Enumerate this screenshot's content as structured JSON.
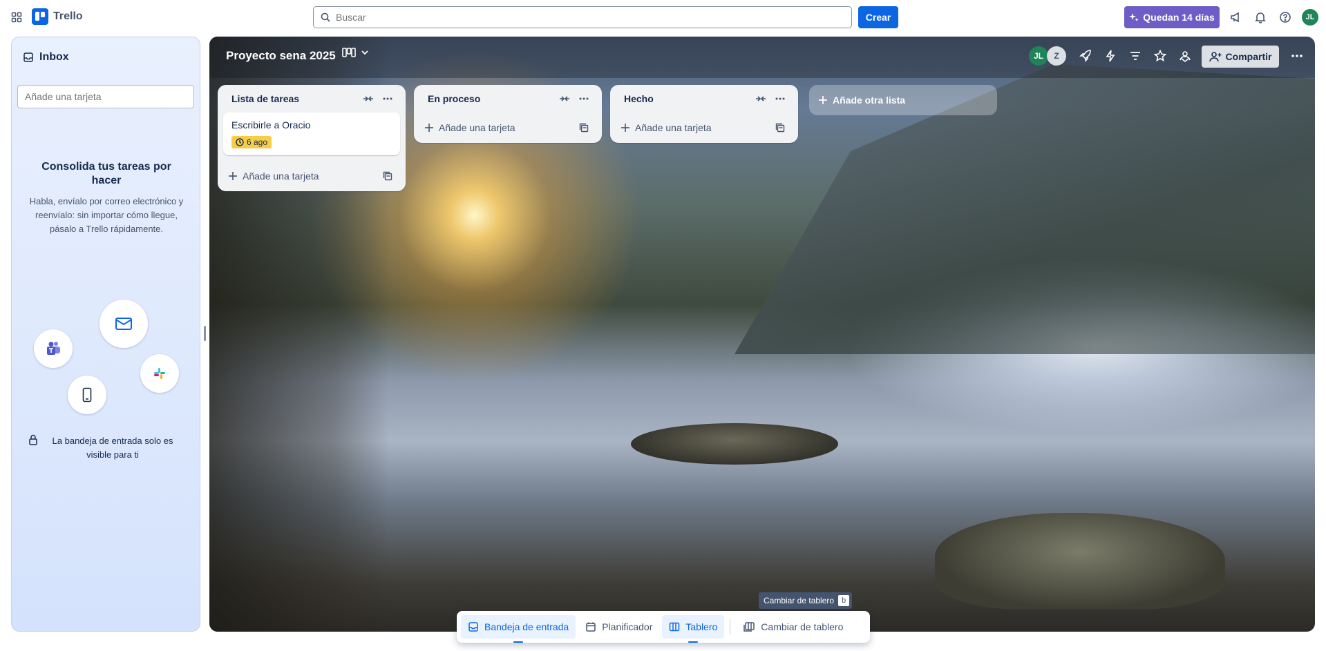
{
  "topbar": {
    "app_name": "Trello",
    "search_placeholder": "Buscar",
    "create_label": "Crear",
    "trial_label": "Quedan 14 días",
    "avatar_initials": "JL"
  },
  "inbox": {
    "title": "Inbox",
    "add_card_placeholder": "Añade una tarjeta",
    "heading": "Consolida tus tareas por hacer",
    "description": "Habla, envíalo por correo electrónico y reenvíalo: sin importar cómo llegue, pásalo a Trello rápidamente.",
    "privacy_note": "La bandeja de entrada solo es visible para ti"
  },
  "board": {
    "title": "Proyecto sena 2025",
    "members": [
      {
        "initials": "JL",
        "color": "#1f845a"
      },
      {
        "initials": "Z",
        "color": "#dcdfe4"
      }
    ],
    "share_label": "Compartir",
    "add_list_label": "Añade otra lista",
    "lists": [
      {
        "title": "Lista de tareas",
        "cards": [
          {
            "title": "Escribirle a Oracio",
            "due": "6 ago",
            "due_color": "#f5cd47"
          }
        ],
        "add_card_label": "Añade una tarjeta"
      },
      {
        "title": "En proceso",
        "cards": [],
        "add_card_label": "Añade una tarjeta"
      },
      {
        "title": "Hecho",
        "cards": [],
        "add_card_label": "Añade una tarjeta"
      }
    ]
  },
  "bottom_bar": {
    "tooltip": "Cambiar de tablero",
    "tooltip_shortcut": "b",
    "items": [
      {
        "label": "Bandeja de entrada",
        "active": true
      },
      {
        "label": "Planificador",
        "active": false
      },
      {
        "label": "Tablero",
        "active": true
      },
      {
        "label": "Cambiar de tablero",
        "active": false
      }
    ]
  },
  "colors": {
    "accent": "#0c66e4",
    "trial": "#6e5dc6",
    "due_badge": "#f5cd47"
  }
}
